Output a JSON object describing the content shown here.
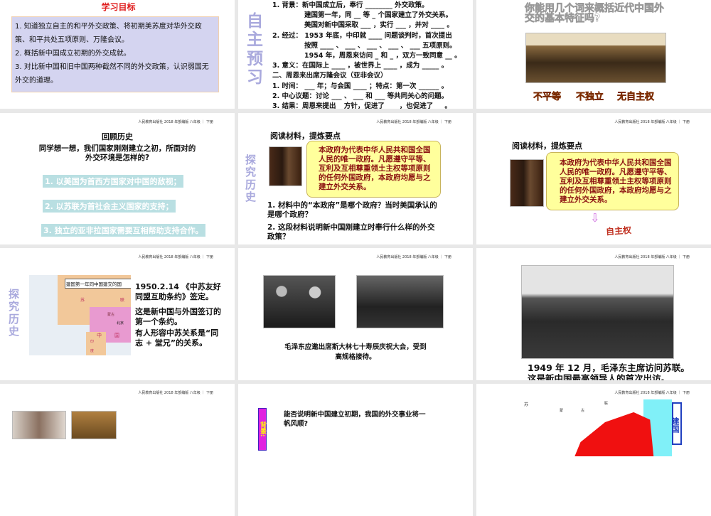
{
  "header_text": "人民教育出版社 2018 年部编版 八年级 ｜ 下册",
  "slide1": {
    "title": "学习目标",
    "lines": [
      "1. 知道独立自主的和平外交政策、将初期美苏度对华外交政策、和平共处五项原则、万隆会议。",
      "2. 概括新中国成立初期的外交成就。",
      "3. 对比新中国和旧中国两种截然不同的外交政策，认识弱国无外交的道理。"
    ]
  },
  "slide2": {
    "side_label": "自主预习",
    "lines": [
      "1. 背景：新中国成立后，奉行 ________ 外交政策。",
      "建国第一年，同 __ 等 _ 个国家建立了外交关系。",
      "美国对新中国采取 ___ ，实行 ___ ，并对 ____ 。",
      "2. 经过： 1953 年底，中印就 ____ 问题谈判时，首次提出",
      "按照 ____ 、 ___ 、 ___ 、 ___ 、 ___ 五项原则。",
      "1954 年，周恩来访问 _ 和 _ ，双方一致同意 __ 。",
      "3. 意义：在国际上 ____ ，被世界上 ____ ，成为 _____ 。",
      "二、周恩来出席万隆会议（亚非会议）",
      "1. 时间： ___ 年；与会国 ____ ；特点：第一次 ______ 。",
      "2. 中心议题：讨论 ___ 、 ___ 和 ___ 等共同关心的问题。",
      "3. 结果：周恩来提出 _ 方针，促进了 ___ ，也促进了 __ 。"
    ]
  },
  "slide3": {
    "question": "你能用几个词来概括近代中国外交的基本特征吗?",
    "words": [
      "不平等",
      "不独立",
      "无自主权"
    ]
  },
  "slide4": {
    "title": "回顾历史",
    "question": "同学想一想，我们国家刚刚建立之初，所面对的外交环境是怎样的?",
    "answers": [
      "1. 以美国为首西方国家对中国的敌视；",
      "2. 以苏联为首社会主义国家的支持；",
      "3. 独立的亚非拉国家需要互相帮助支持合作。"
    ]
  },
  "slide5": {
    "side_label": "探究历史",
    "title": "阅读材料，提炼要点",
    "quote": "本政府为代表中华人民共和国全国人民的唯一政府。凡愿遵守平等、互利及互相尊重领土主权等项原则的任何外国政府，本政府均愿与之建立外交关系。",
    "q1": "1. 材料中的“本政府”是哪个政府？当时美国承认的是哪个政府？",
    "q2": "2. 这段材料说明新中国刚建立时奉行什么样的外交政策？"
  },
  "slide6": {
    "title": "阅读材料，提炼要点",
    "quote": "本政府为代表中华人民共和国全国人民的唯一政府。凡愿遵守平等、互利及互相尊重领土主权等项原则的任何外国政府，本政府均愿与之建立外交关系。",
    "answer": "自主权"
  },
  "slide7": {
    "side_label": "探究历史",
    "map_title": "建国第一年同中国建交的国",
    "map_labels": [
      "苏",
      "联",
      "中",
      "国",
      "蒙古",
      "北京",
      "印",
      "度"
    ],
    "p1": "1950.2.14 《中苏友好同盟互助条约》签定。",
    "p2": "这是新中国与外国签订的第一个条约。",
    "p3": "有人形容中苏关系是“同志 + 堂兄”的关系。"
  },
  "slide8": {
    "caption": "毛泽东应邀出席斯大林七十寿辰庆祝大会，受到高规格接待。"
  },
  "slide9": {
    "caption1": "1949 年 12 月，毛泽东主席访问苏联。",
    "caption2": "这是新中国最高领导人的首次出访。"
  },
  "slide11": {
    "tag": "背景:",
    "question": "能否说明新中国建立初期，我国的外交事业将一帆风顺?"
  },
  "slide12": {
    "labels": [
      "苏",
      "蒙",
      "古",
      "联"
    ],
    "box": "建国"
  }
}
